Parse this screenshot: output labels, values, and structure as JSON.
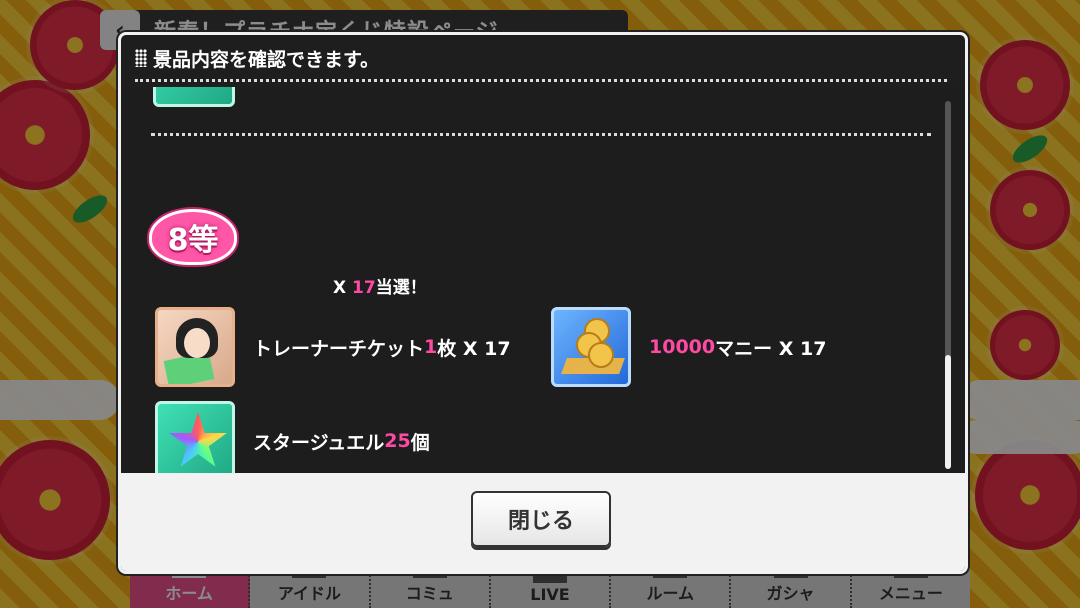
{
  "background": {
    "page_title": "新春！プラチナ宝くじ特設ページ",
    "back_icon": "chevron-left-icon",
    "nav": [
      {
        "label": "ホーム",
        "icon": "home-icon",
        "active": true
      },
      {
        "label": "アイドル",
        "icon": "idol-icon",
        "active": false
      },
      {
        "label": "コミュ",
        "icon": "commu-icon",
        "active": false
      },
      {
        "label": "LIVE",
        "icon": "live-icon",
        "active": false
      },
      {
        "label": "ルーム",
        "icon": "room-icon",
        "active": false
      },
      {
        "label": "ガシャ",
        "icon": "gacha-icon",
        "active": false
      },
      {
        "label": "メニュー",
        "icon": "menu-icon",
        "active": false
      }
    ]
  },
  "modal": {
    "title": "景品内容を確認できます。",
    "rank": "8等",
    "win": {
      "prefix": "X ",
      "count": "17",
      "suffix": "当選！"
    },
    "prizes": [
      {
        "icon": "trainer-ticket-icon",
        "name": "トレーナーチケット ",
        "qty": "1",
        "unit": "枚 X 17"
      },
      {
        "icon": "money-icon",
        "name": "",
        "qty": "10000",
        "unit": "マニー X 17"
      },
      {
        "icon": "star-jewel-icon",
        "name": "スタージュエル",
        "qty": "25",
        "unit": "個"
      }
    ],
    "close_label": "閉じる"
  },
  "colors": {
    "accent_pink": "#ff4aa5",
    "modal_bg": "#1e1e1e",
    "nav_active": "#ec4f8c"
  }
}
